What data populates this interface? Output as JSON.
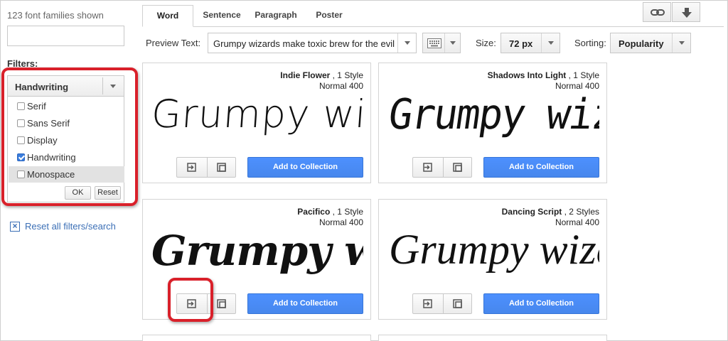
{
  "sidebar": {
    "count_text": "123 font families shown",
    "search_value": "",
    "filters_label": "Filters:",
    "category_select": "Handwriting",
    "options": [
      {
        "label": "Serif",
        "checked": false
      },
      {
        "label": "Sans Serif",
        "checked": false
      },
      {
        "label": "Display",
        "checked": false
      },
      {
        "label": "Handwriting",
        "checked": true
      },
      {
        "label": "Monospace",
        "checked": false
      }
    ],
    "ok_label": "OK",
    "reset_label": "Reset",
    "reset_all_label": "Reset all filters/search",
    "reset_all_icon": "x-box-icon"
  },
  "tabs": [
    {
      "label": "Word",
      "active": true
    },
    {
      "label": "Sentence",
      "active": false
    },
    {
      "label": "Paragraph",
      "active": false
    },
    {
      "label": "Poster",
      "active": false
    }
  ],
  "top_icons": [
    "link-icon",
    "download-icon"
  ],
  "toolbar": {
    "preview_label": "Preview Text:",
    "preview_value": "Grumpy wizards make toxic brew for the evil",
    "keyboard_icon": "keyboard-icon",
    "size_label": "Size:",
    "size_value": "72 px",
    "sorting_label": "Sorting:",
    "sorting_value": "Popularity"
  },
  "card_buttons": {
    "add_label": "Add to Collection",
    "quick_use_icon": "quick-use-icon",
    "pop_out_icon": "pop-out-icon"
  },
  "cards": [
    {
      "name": "Indie Flower",
      "styles": ", 1 Style",
      "weight": "Normal 400",
      "preview": "Grumpy wizards"
    },
    {
      "name": "Shadows Into Light",
      "styles": ", 1 Style",
      "weight": "Normal 400",
      "preview": "Grumpy wizards"
    },
    {
      "name": "Pacifico",
      "styles": ", 1 Style",
      "weight": "Normal 400",
      "preview": "Grumpy wizards"
    },
    {
      "name": "Dancing Script",
      "styles": ", 2 Styles",
      "weight": "Normal 400",
      "preview": "Grumpy wizards"
    }
  ],
  "colors": {
    "accent_blue": "#4d90fe",
    "highlight_red": "#d9202a",
    "link_blue": "#3b6fb6"
  }
}
